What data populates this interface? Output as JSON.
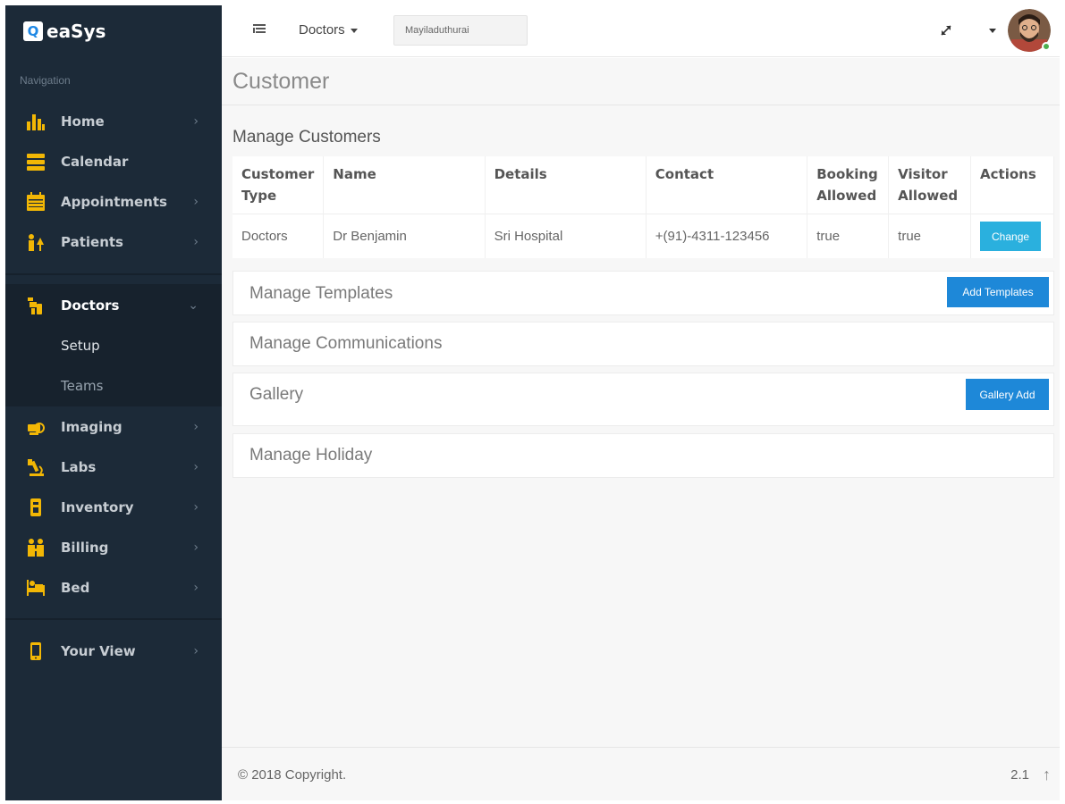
{
  "brand": {
    "logo_letter": "Q",
    "name": "eaSys"
  },
  "sidebar": {
    "caption": "Navigation",
    "items": [
      {
        "label": "Home",
        "icon": "bar-chart-icon"
      },
      {
        "label": "Calendar",
        "icon": "server-stack-icon"
      },
      {
        "label": "Appointments",
        "icon": "calendar-icon"
      },
      {
        "label": "Patients",
        "icon": "patients-icon"
      },
      {
        "label": "Doctors",
        "icon": "doctor-icon"
      },
      {
        "label": "Imaging",
        "icon": "imaging-icon"
      },
      {
        "label": "Labs",
        "icon": "microscope-icon"
      },
      {
        "label": "Inventory",
        "icon": "inventory-icon"
      },
      {
        "label": "Billing",
        "icon": "billing-icon"
      },
      {
        "label": "Bed",
        "icon": "bed-icon"
      },
      {
        "label": "Your View",
        "icon": "mobile-icon"
      }
    ],
    "doctors_sub": [
      {
        "label": "Setup"
      },
      {
        "label": "Teams"
      }
    ],
    "accent_color": "#f2b705"
  },
  "topbar": {
    "dropdown_label": "Doctors",
    "location_value": "Mayiladuthurai"
  },
  "main": {
    "page_title": "Customer",
    "section_title": "Manage Customers",
    "table": {
      "headers": [
        {
          "line1": "Customer",
          "line2": "Type"
        },
        {
          "line1": "Name",
          "line2": ""
        },
        {
          "line1": "Details",
          "line2": ""
        },
        {
          "line1": "Contact",
          "line2": ""
        },
        {
          "line1": "Booking",
          "line2": "Allowed"
        },
        {
          "line1": "Visitor",
          "line2": "Allowed"
        },
        {
          "line1": "Actions",
          "line2": ""
        }
      ],
      "rows": [
        {
          "type": "Doctors",
          "name": "Dr Benjamin",
          "details": "Sri Hospital",
          "contact": "+(91)-4311-123456",
          "booking": "true",
          "visitor": "true",
          "action": "Change"
        }
      ]
    },
    "panels": {
      "templates": {
        "title": "Manage Templates",
        "button": "Add Templates"
      },
      "communications": {
        "title": "Manage Communications"
      },
      "gallery": {
        "title": "Gallery",
        "button": "Gallery Add"
      },
      "holiday": {
        "title": "Manage Holiday"
      }
    }
  },
  "footer": {
    "copyright": "© 2018 Copyright.",
    "version": "2.1"
  },
  "colors": {
    "primary_button": "#1e88d8",
    "info_button": "#2ab0de",
    "sidebar_bg": "#1c2a38"
  }
}
